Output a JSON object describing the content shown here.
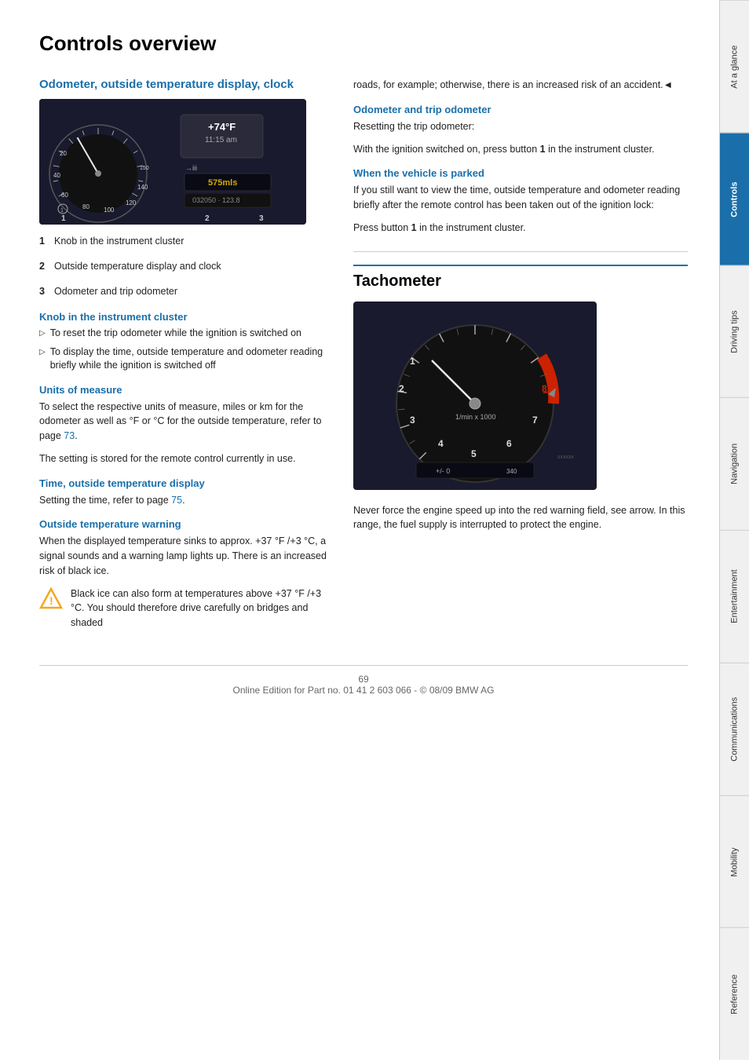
{
  "page": {
    "title": "Controls overview",
    "footer_page": "69",
    "footer_text": "Online Edition for Part no. 01 41 2 603 066 - © 08/09 BMW AG"
  },
  "sidebar": {
    "tabs": [
      {
        "label": "At a glance",
        "active": false
      },
      {
        "label": "Controls",
        "active": true
      },
      {
        "label": "Driving tips",
        "active": false
      },
      {
        "label": "Navigation",
        "active": false
      },
      {
        "label": "Entertainment",
        "active": false
      },
      {
        "label": "Communications",
        "active": false
      },
      {
        "label": "Mobility",
        "active": false
      },
      {
        "label": "Reference",
        "active": false
      }
    ]
  },
  "section1": {
    "heading": "Odometer, outside temperature display, clock",
    "labels": [
      {
        "num": "1",
        "text": "Knob in the instrument cluster"
      },
      {
        "num": "2",
        "text": "Outside temperature display and clock"
      },
      {
        "num": "3",
        "text": "Odometer and trip odometer"
      }
    ],
    "subsection_knob": {
      "heading": "Knob in the instrument cluster",
      "bullets": [
        "To reset the trip odometer while the ignition is switched on",
        "To display the time, outside temperature and odometer reading briefly while the ignition is switched off"
      ]
    },
    "subsection_units": {
      "heading": "Units of measure",
      "text1": "To select the respective units of measure, miles or km for the odometer as well as  °F  or  °C for the outside temperature, refer to page ",
      "page_ref1": "73",
      "text1b": ".",
      "text2": "The setting is stored for the remote control currently in use."
    },
    "subsection_time": {
      "heading": "Time, outside temperature display",
      "text": "Setting the time, refer to page ",
      "page_ref": "75",
      "text_end": "."
    },
    "subsection_warning": {
      "heading": "Outside temperature warning",
      "text": "When the displayed temperature sinks to approx. +37 °F /+3 °C, a signal sounds and a warning lamp lights up. There is an increased risk of black ice.",
      "warning_box_text": "Black ice can also form at temperatures above +37 °F /+3 °C. You should therefore drive carefully on bridges and shaded"
    }
  },
  "col_right": {
    "intro_text": "roads, for example; otherwise, there is an increased risk of an accident.◄",
    "odometer_section": {
      "heading": "Odometer and trip odometer",
      "text": "Resetting the trip odometer:",
      "text2": "With the ignition switched on, press button ",
      "bold_part": "1",
      "text3": " in the instrument cluster."
    },
    "parked_section": {
      "heading": "When the vehicle is parked",
      "text": "If you still want to view the time, outside temperature and odometer reading briefly after the remote control has been taken out of the ignition lock:",
      "text2": "Press button ",
      "bold_part": "1",
      "text3": " in the instrument cluster."
    }
  },
  "tachometer": {
    "heading": "Tachometer",
    "text": "Never force the engine speed up into the red warning field, see arrow. In this range, the fuel supply is interrupted to protect the engine."
  }
}
